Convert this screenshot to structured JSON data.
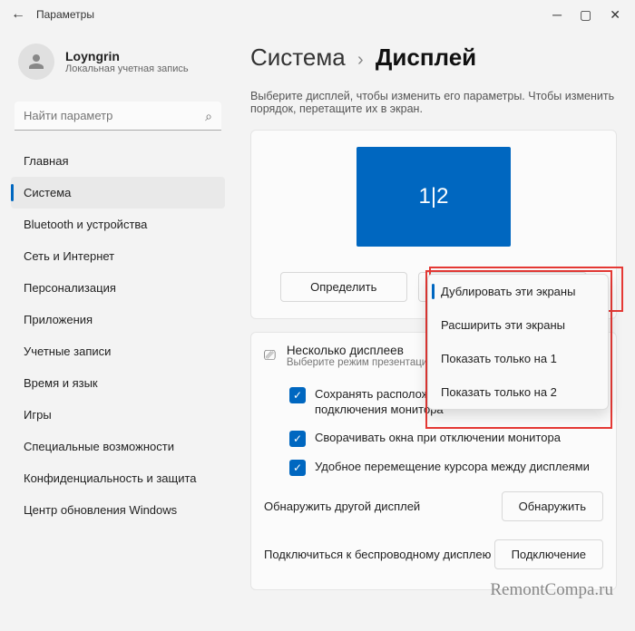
{
  "titlebar": {
    "title": "Параметры"
  },
  "account": {
    "name": "Loyngrin",
    "sub": "Локальная учетная запись"
  },
  "search": {
    "placeholder": "Найти параметр"
  },
  "nav": {
    "items": [
      "Главная",
      "Система",
      "Bluetooth и устройства",
      "Сеть и Интернет",
      "Персонализация",
      "Приложения",
      "Учетные записи",
      "Время и язык",
      "Игры",
      "Специальные возможности",
      "Конфиденциальность и защита",
      "Центр обновления Windows"
    ],
    "active_index": 1
  },
  "breadcrumb": {
    "parent": "Система",
    "current": "Дисплей"
  },
  "instruction": "Выберите дисплей, чтобы изменить его параметры. Чтобы изменить порядок, перетащите их в экран.",
  "monitor_label": "1|2",
  "buttons": {
    "identify": "Определить",
    "mode": "Дублировать эти экраны"
  },
  "dropdown": {
    "items": [
      "Дублировать эти экраны",
      "Расширить эти экраны",
      "Показать только на 1",
      "Показать только на 2"
    ],
    "selected_index": 0
  },
  "multidisplay": {
    "title": "Несколько дисплеев",
    "sub": "Выберите режим презентации для",
    "chk1": "Сохранять расположение окон в зависимости от подключения монитора",
    "chk2": "Сворачивать окна при отключении монитора",
    "chk3": "Удобное перемещение курсора между дисплеями",
    "detect_label": "Обнаружить другой дисплей",
    "detect_btn": "Обнаружить",
    "wireless_label": "Подключиться к беспроводному дисплею",
    "wireless_btn": "Подключение"
  },
  "watermark": "RemontCompa.ru"
}
